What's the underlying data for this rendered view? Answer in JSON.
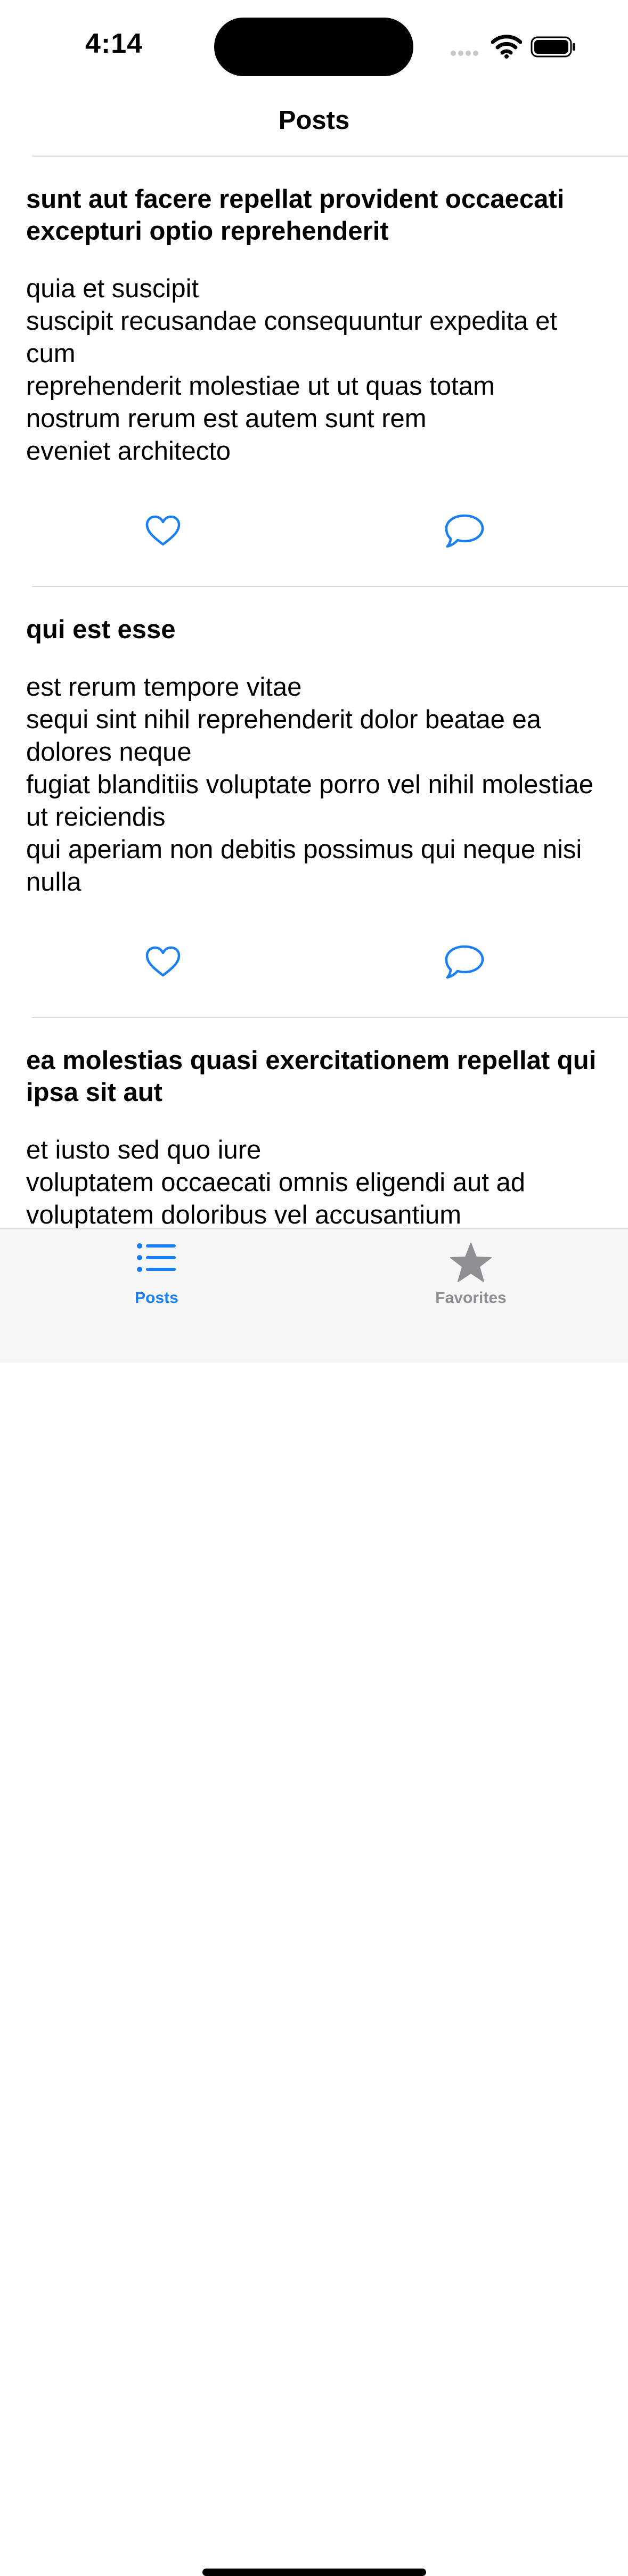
{
  "status": {
    "time": "4:14"
  },
  "nav": {
    "title": "Posts"
  },
  "posts": [
    {
      "title": "sunt aut facere repellat provident occaecati excepturi optio reprehenderit",
      "body": "quia et suscipit\nsuscipit recusandae consequuntur expedita et cum\nreprehenderit molestiae ut ut quas totam\nnostrum rerum est autem sunt rem\neveniet architecto"
    },
    {
      "title": "qui est esse",
      "body": "est rerum tempore vitae\nsequi sint nihil reprehenderit dolor beatae ea dolores neque\nfugiat blanditiis voluptate porro vel nihil molestiae ut reiciendis\nqui aperiam non debitis possimus qui neque nisi nulla"
    },
    {
      "title": "ea molestias quasi exercitationem repellat qui ipsa sit aut",
      "body": "et iusto sed quo iure\nvoluptatem occaecati omnis eligendi aut ad\nvoluptatem doloribus vel accusantium\nquis pariatur\nmolestiae porro eius odio et labore et velit aut"
    }
  ],
  "icons": {
    "like": "heart-icon",
    "comment": "speech-bubble-icon"
  },
  "tabs": [
    {
      "label": "Posts",
      "icon": "list-bullet-icon",
      "selected": true
    },
    {
      "label": "Favorites",
      "icon": "star-icon",
      "selected": false
    }
  ],
  "colors": {
    "accent": "#1a7ff3",
    "inactive": "#8e8e93",
    "tabbar_bg": "#f6f6f6",
    "separator": "#dcdcde"
  }
}
